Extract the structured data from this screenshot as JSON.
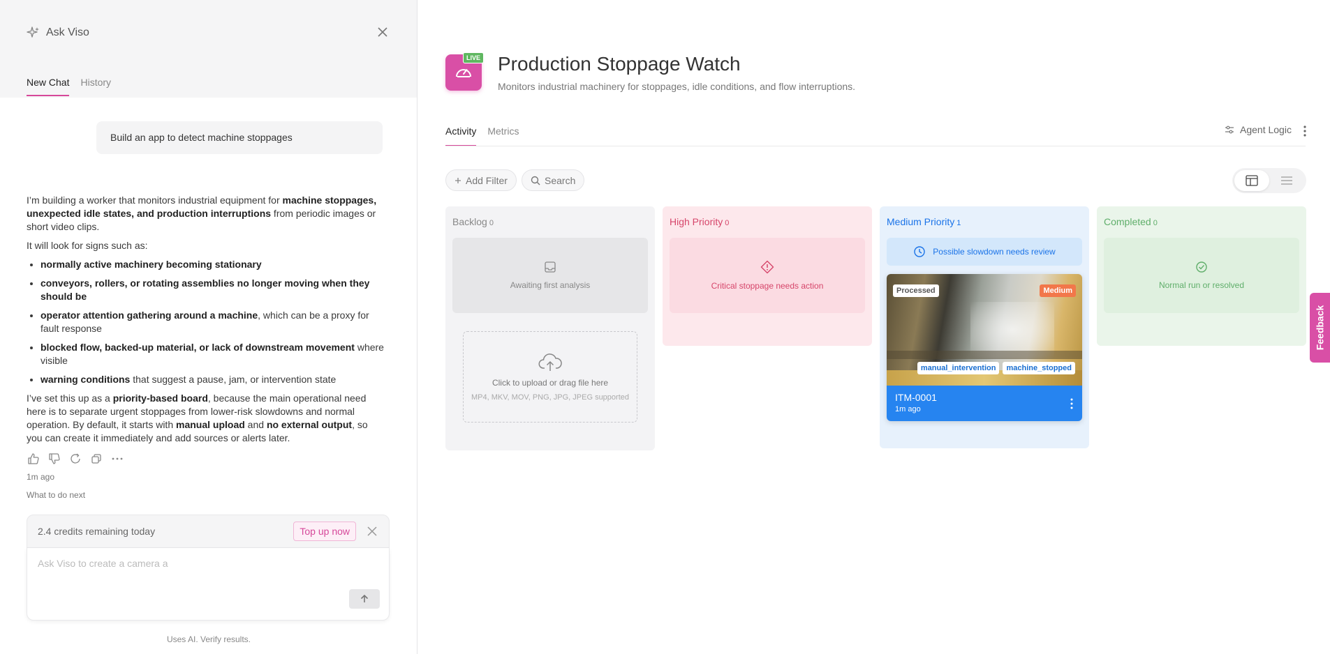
{
  "chat": {
    "title": "Ask Viso",
    "tabs": [
      {
        "label": "New Chat",
        "active": true
      },
      {
        "label": "History",
        "active": false
      }
    ],
    "user_message": "Build an app to detect machine stoppages",
    "reply": {
      "p1_a": "I’m building a worker that monitors industrial equipment for ",
      "p1_b": "machine stoppages, unexpected idle states, and production interruptions",
      "p1_c": " from periodic images or short video clips.",
      "p2": "It will look for signs such as:",
      "bullets": [
        {
          "bold": "normally active machinery becoming stationary",
          "rest": ""
        },
        {
          "bold": "conveyors, rollers, or rotating assemblies no longer moving when they should be",
          "rest": ""
        },
        {
          "bold": "operator attention gathering around a machine",
          "rest": ", which can be a proxy for fault response"
        },
        {
          "bold": "blocked flow, backed-up material, or lack of downstream movement",
          "rest": " where visible"
        },
        {
          "bold": "warning conditions",
          "rest": " that suggest a pause, jam, or intervention state"
        }
      ],
      "p3_a": "I’ve set this up as a ",
      "p3_b": "priority-based board",
      "p3_c": ", because the main operational need here is to separate urgent stoppages from lower-risk slowdowns and normal operation. By default, it starts with ",
      "p3_d": "manual upload",
      "p3_e": " and ",
      "p3_f": "no external output",
      "p3_g": ", so you can create it immediately and add sources or alerts later."
    },
    "time_ago": "1m ago",
    "next_label": "What to do next",
    "credits_text": "2.4 credits remaining today",
    "topup_label": "Top up now",
    "input_placeholder": "Ask Viso to create a camera a",
    "disclaimer": "Uses AI. Verify results."
  },
  "app": {
    "live_badge": "LIVE",
    "title": "Production Stoppage Watch",
    "subtitle": "Monitors industrial machinery for stoppages, idle conditions, and flow interruptions.",
    "tabs": [
      {
        "label": "Activity",
        "active": true
      },
      {
        "label": "Metrics",
        "active": false
      }
    ],
    "agent_logic_label": "Agent Logic",
    "add_filter_label": "Add Filter",
    "search_label": "Search"
  },
  "board": {
    "columns": [
      {
        "title": "Backlog",
        "count": "0",
        "state_text": "Awaiting first analysis",
        "color": "#888888",
        "bg": "#f3f3f5",
        "box_bg": "#e6e6e8"
      },
      {
        "title": "High Priority",
        "count": "0",
        "state_text": "Critical stoppage needs action",
        "color": "#d6456a",
        "bg": "#fde8ec",
        "box_bg": "#fbdbe2"
      },
      {
        "title": "Medium Priority",
        "count": "1",
        "state_text": "Possible slowdown needs review",
        "color": "#1a73e8",
        "bg": "#e7f1fc",
        "box_bg": "#d3e7fb"
      },
      {
        "title": "Completed",
        "count": "0",
        "state_text": "Normal run or resolved",
        "color": "#5fae6a",
        "bg": "#eaf5ea",
        "box_bg": "#dff0df"
      }
    ],
    "upload": {
      "title": "Click to upload or drag file here",
      "formats": "MP4, MKV, MOV, PNG, JPG, JPEG supported"
    },
    "card": {
      "status": "Processed",
      "priority": "Medium",
      "tags": [
        "manual_intervention",
        "machine_stopped"
      ],
      "id": "ITM-0001",
      "time": "1m ago"
    }
  },
  "feedback_label": "Feedback",
  "colors": {
    "accent": "#d6489a",
    "blue": "#2684f0",
    "live": "#5fb760"
  }
}
